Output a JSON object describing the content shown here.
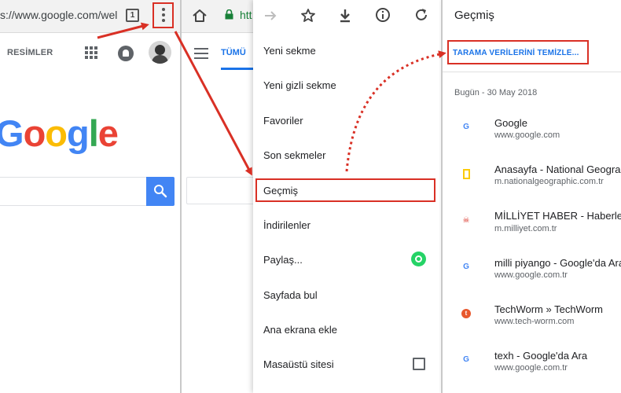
{
  "panel1": {
    "url": "s://www.google.com/wel",
    "tab_count": "1",
    "images_label": "RESİMLER",
    "logo": "Google"
  },
  "panel2": {
    "url": "htt",
    "tab_label": "TÜMÜ"
  },
  "menu": {
    "items": [
      {
        "label": "Yeni sekme"
      },
      {
        "label": "Yeni gizli sekme"
      },
      {
        "label": "Favoriler"
      },
      {
        "label": "Son sekmeler"
      },
      {
        "label": "Geçmiş"
      },
      {
        "label": "İndirilenler"
      },
      {
        "label": "Paylaş..."
      },
      {
        "label": "Sayfada bul"
      },
      {
        "label": "Ana ekrana ekle"
      },
      {
        "label": "Masaüstü sitesi"
      }
    ]
  },
  "history": {
    "title": "Geçmiş",
    "clear_label": "TARAMA VERİLERİNİ TEMİZLE...",
    "date_header": "Bugün - 30 May 2018",
    "entries": [
      {
        "title": "Google",
        "url": "www.google.com",
        "icon": "google-icon"
      },
      {
        "title": "Anasayfa - National Geographic",
        "url": "m.nationalgeographic.com.tr",
        "icon": "natgeo-icon"
      },
      {
        "title": "MİLLİYET HABER - Haberler - S",
        "url": "m.milliyet.com.tr",
        "icon": "milliyet-icon"
      },
      {
        "title": "milli piyango - Google'da Ara",
        "url": "www.google.com.tr",
        "icon": "google-icon"
      },
      {
        "title": "TechWorm » TechWorm",
        "url": "www.tech-worm.com",
        "icon": "techworm-icon"
      },
      {
        "title": "texh - Google'da Ara",
        "url": "www.google.com.tr",
        "icon": "google-icon"
      }
    ]
  },
  "colors": {
    "highlight_red": "#d93025",
    "link_blue": "#1a73e8",
    "google_blue": "#4285f4",
    "google_red": "#ea4335",
    "google_yellow": "#fbbc05",
    "google_green": "#34a853"
  }
}
